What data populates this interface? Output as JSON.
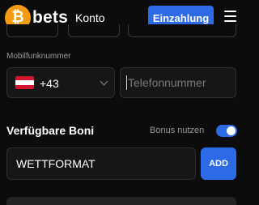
{
  "header": {
    "logo_mark": "₿",
    "logo_text": "bets",
    "nav_konto": "Konto",
    "deposit_label": "Einzahlung",
    "menu_icon": "hamburger-menu-icon"
  },
  "form": {
    "mobile_label": "Mobilfunknummer",
    "country_code": "+43",
    "country_flag": "austria-flag-icon",
    "phone_placeholder": "Telefonnummer",
    "phone_value": ""
  },
  "bonus": {
    "title": "Verfügbare Boni",
    "use_label": "Bonus nutzen",
    "toggle_on": true,
    "code_value": "WETTFORMAT",
    "add_label": "ADD"
  },
  "colors": {
    "background": "#0c0c0c",
    "accent": "#2d6be6",
    "logo": "#f39c12",
    "field": "#161616"
  }
}
